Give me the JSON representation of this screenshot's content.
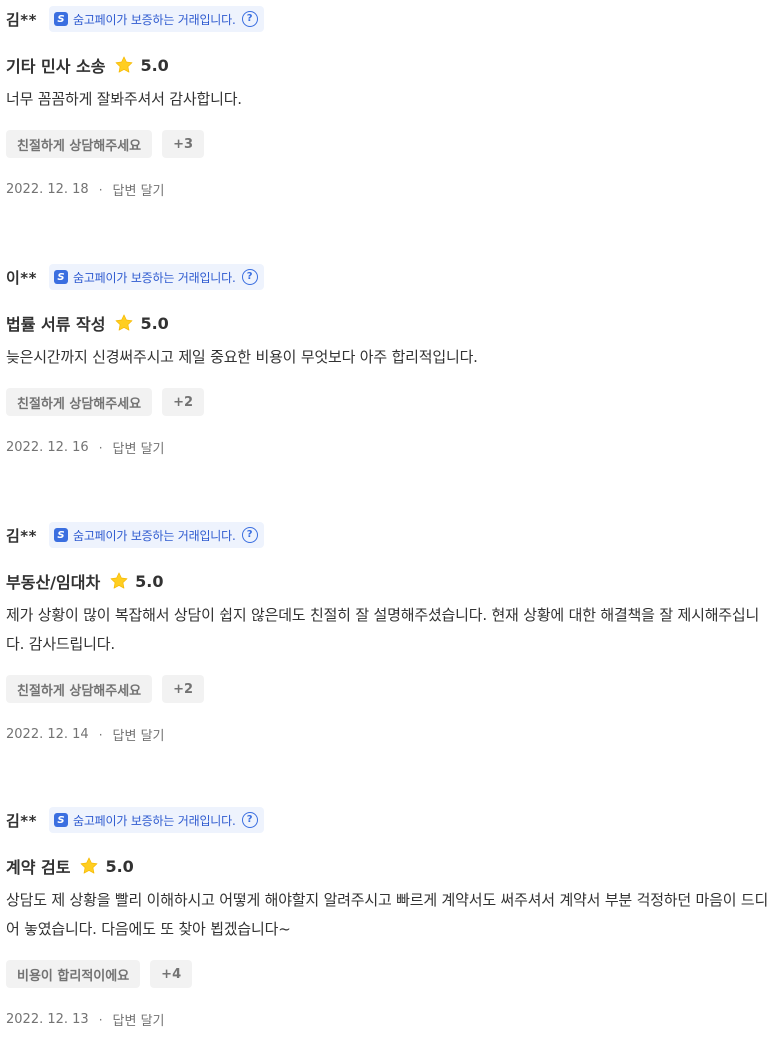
{
  "reviews": [
    {
      "reviewer": "김**",
      "pay_badge": "숨고페이가 보증하는 거래입니다.",
      "service": "기타 민사 소송",
      "rating": "5.0",
      "text": "너무 꼼꼼하게 잘봐주셔서 감사합니다.",
      "tags": [
        "친절하게 상담해주세요",
        "+3"
      ],
      "date": "2022. 12. 18",
      "reply_label": "답변 달기"
    },
    {
      "reviewer": "이**",
      "pay_badge": "숨고페이가 보증하는 거래입니다.",
      "service": "법률 서류 작성",
      "rating": "5.0",
      "text": "늦은시간까지 신경써주시고 제일 중요한 비용이 무엇보다 아주 합리적입니다.",
      "tags": [
        "친절하게 상담해주세요",
        "+2"
      ],
      "date": "2022. 12. 16",
      "reply_label": "답변 달기"
    },
    {
      "reviewer": "김**",
      "pay_badge": "숨고페이가 보증하는 거래입니다.",
      "service": "부동산/임대차",
      "rating": "5.0",
      "text": "제가 상황이 많이 복잡해서 상담이 쉽지 않은데도 친절히 잘 설명해주셨습니다. 현재 상황에 대한 해결책을 잘 제시해주십니다. 감사드립니다.",
      "tags": [
        "친절하게 상담해주세요",
        "+2"
      ],
      "date": "2022. 12. 14",
      "reply_label": "답변 달기"
    },
    {
      "reviewer": "김**",
      "pay_badge": "숨고페이가 보증하는 거래입니다.",
      "service": "계약 검토",
      "rating": "5.0",
      "text": "상담도 제 상황을 빨리 이해하시고 어떻게 해야할지 알려주시고 빠르게 계약서도 써주셔서 계약서 부분 걱정하던 마음이 드디어 놓였습니다. 다음에도 또 찾아 뵙겠습니다~",
      "tags": [
        "비용이 합리적이에요",
        "+4"
      ],
      "date": "2022. 12. 13",
      "reply_label": "답변 달기"
    }
  ],
  "colors": {
    "text": "#323232",
    "muted": "#737373",
    "badge_bg": "#eef3fd",
    "badge_text": "#2f5bd0",
    "star": "#ffce21",
    "tag_bg": "#f2f2f2"
  },
  "icons": {
    "pay_logo": "sumgo-pay-logo-icon",
    "help": "question-circle-icon",
    "star": "star-icon"
  }
}
